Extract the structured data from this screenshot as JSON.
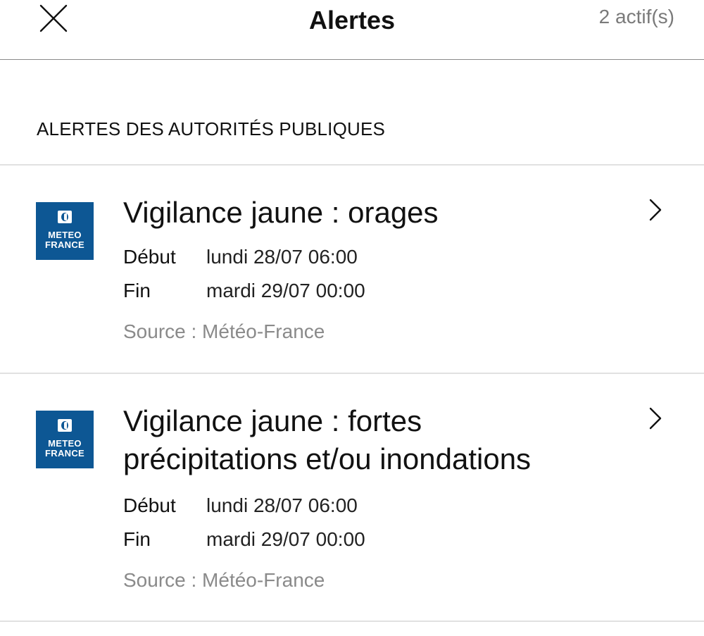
{
  "header": {
    "title": "Alertes",
    "count": "2 actif(s)"
  },
  "section": {
    "title": "ALERTES DES AUTORITÉS PUBLIQUES"
  },
  "alerts": [
    {
      "title_line1": "Vigilance jaune : orages",
      "logo_line1": "METEO",
      "logo_line2": "FRANCE",
      "start_label": "Début",
      "start_value": "lundi 28/07 06:00",
      "end_label": "Fin",
      "end_value": "mardi 29/07 00:00",
      "source": "Source : Météo-France"
    },
    {
      "title_line1": "Vigilance jaune : fortes",
      "title_line2": "précipitations et/ou inondations",
      "logo_line1": "METEO",
      "logo_line2": "FRANCE",
      "start_label": "Début",
      "start_value": "lundi 28/07 06:00",
      "end_label": "Fin",
      "end_value": "mardi 29/07 00:00",
      "source": "Source : Météo-France"
    }
  ],
  "colors": {
    "logo_bg": "#0d5794",
    "muted_text": "#8a8a8a",
    "divider": "#e1e1e1"
  },
  "icons": {
    "close": "close-icon",
    "chevron": "chevron-right-icon"
  }
}
